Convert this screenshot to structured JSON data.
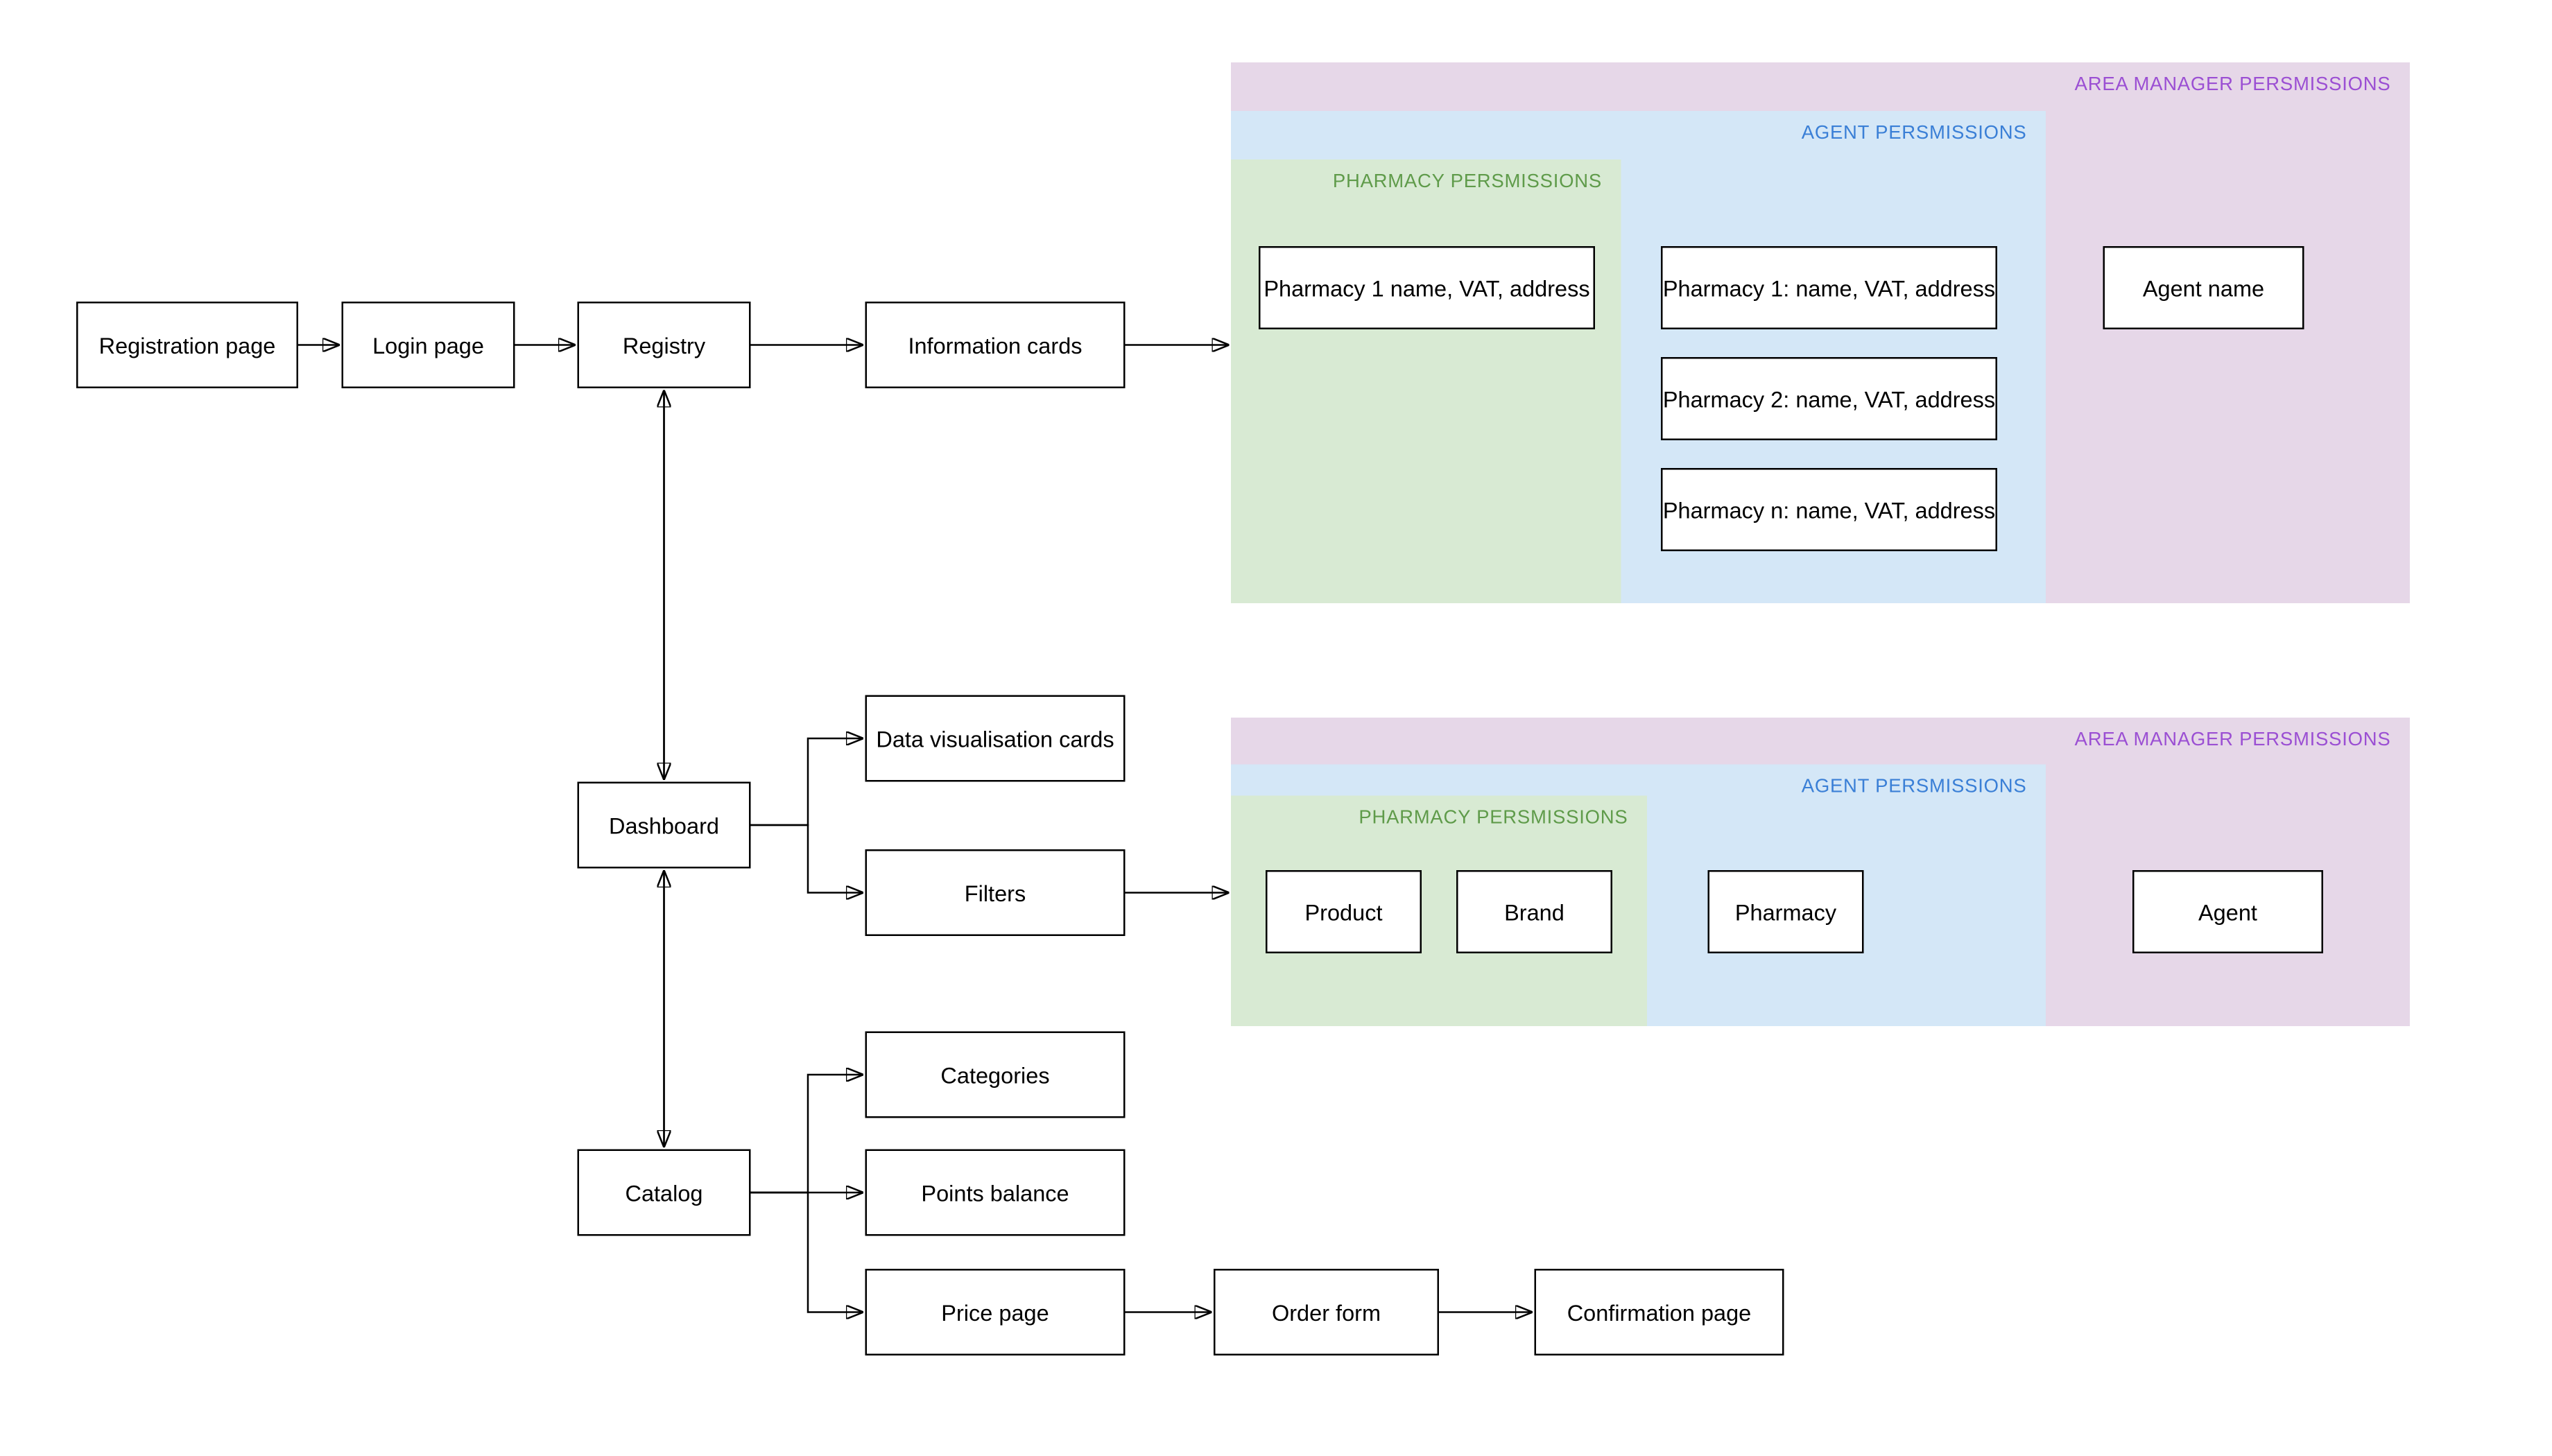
{
  "flow": {
    "registration": "Registration page",
    "login": "Login page",
    "registry": "Registry",
    "information_cards": "Information cards",
    "dashboard": "Dashboard",
    "data_vis_cards": "Data visualisation cards",
    "filters": "Filters",
    "catalog": "Catalog",
    "categories": "Categories",
    "points_balance": "Points balance",
    "price_page": "Price page",
    "order_form": "Order form",
    "confirmation_page": "Confirmation page"
  },
  "permissions_top": {
    "area_label": "AREA MANAGER PERSMISSIONS",
    "agent_label": "AGENT PERSMISSIONS",
    "pharmacy_label": "PHARMACY PERSMISSIONS",
    "pharmacy_card": "Pharmacy 1 name, VAT, address",
    "agent_cards": {
      "p1": "Pharmacy 1: name, VAT, address",
      "p2": "Pharmacy 2: name, VAT, address",
      "pn": "Pharmacy n: name, VAT, address"
    },
    "area_card": "Agent name"
  },
  "permissions_bottom": {
    "area_label": "AREA MANAGER PERSMISSIONS",
    "agent_label": "AGENT PERSMISSIONS",
    "pharmacy_label": "PHARMACY PERSMISSIONS",
    "pharmacy_cards": {
      "product": "Product",
      "brand": "Brand"
    },
    "agent_card": "Pharmacy",
    "area_card": "Agent"
  }
}
